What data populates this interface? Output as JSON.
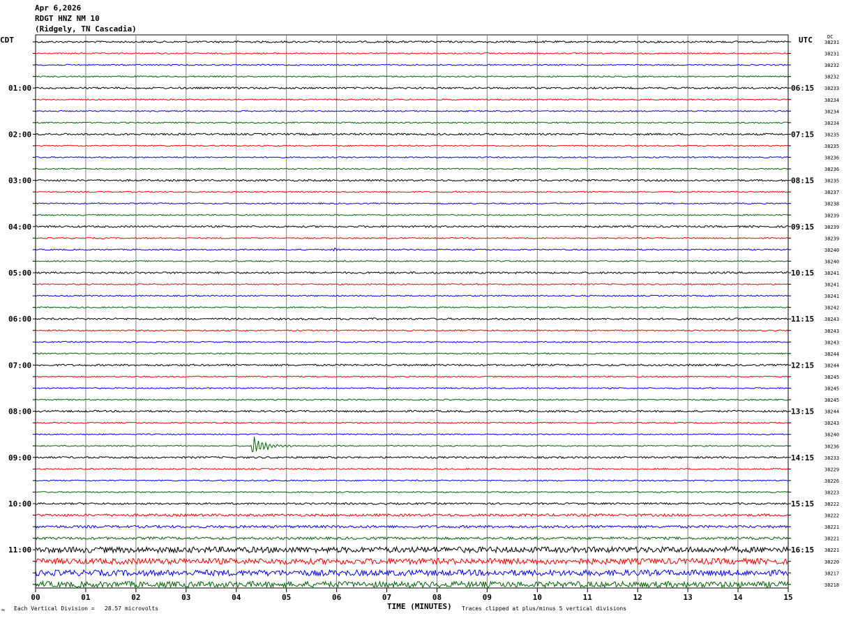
{
  "header": {
    "date": "Apr 6,2026",
    "station": "RDGT HNZ NM 10",
    "location": "(Ridgely, TN Cascadia)"
  },
  "left_zone": "CDT",
  "right_zone": "UTC",
  "dc_label": "DC",
  "footer": {
    "scale": "Each Vertical Division =   28.57 microvolts",
    "clip": "Traces clipped at plus/minus 5 vertical divisions",
    "corner_mark": "≈"
  },
  "colors": {
    "black": "#000000",
    "red": "#ff0000",
    "blue": "#0000ff",
    "green": "#006400",
    "grid": "#808080"
  },
  "chart_data": {
    "type": "line",
    "title": "RDGT HNZ NM 10",
    "xlabel": "TIME (MINUTES)",
    "ylabel": "",
    "xlim": [
      0,
      15
    ],
    "x_ticks": [
      "00",
      "01",
      "02",
      "03",
      "04",
      "05",
      "06",
      "07",
      "08",
      "09",
      "10",
      "11",
      "12",
      "13",
      "14",
      "15"
    ],
    "row_color_cycle": [
      "black",
      "red",
      "blue",
      "green"
    ],
    "left_hour_labels": [
      "01:00",
      "02:00",
      "03:00",
      "04:00",
      "05:00",
      "06:00",
      "07:00",
      "08:00",
      "09:00",
      "10:00",
      "11:00"
    ],
    "right_hour_labels": [
      "06:15",
      "07:15",
      "08:15",
      "09:15",
      "10:15",
      "11:15",
      "12:15",
      "13:15",
      "14:15",
      "15:15",
      "16:15"
    ],
    "dc_offsets": [
      38231,
      38231,
      38232,
      38232,
      38233,
      38234,
      38234,
      38234,
      38235,
      38235,
      38236,
      38236,
      38235,
      38237,
      38238,
      38239,
      38239,
      38239,
      38240,
      38240,
      38241,
      38241,
      38241,
      38242,
      38243,
      38243,
      38243,
      38244,
      38244,
      38245,
      38245,
      38245,
      38244,
      38243,
      38240,
      38236,
      38233,
      38229,
      38226,
      38223,
      38222,
      38222,
      38221,
      38221,
      38221,
      38220,
      38217,
      38218
    ],
    "events": [
      {
        "row": 35,
        "minute": 4.3,
        "duration_min": 0.8,
        "amplitude": 16,
        "note": "earthquake signal"
      },
      {
        "row": 18,
        "minute": 5.93,
        "duration_min": 0.15,
        "amplitude": 6,
        "note": "small transient"
      }
    ]
  }
}
